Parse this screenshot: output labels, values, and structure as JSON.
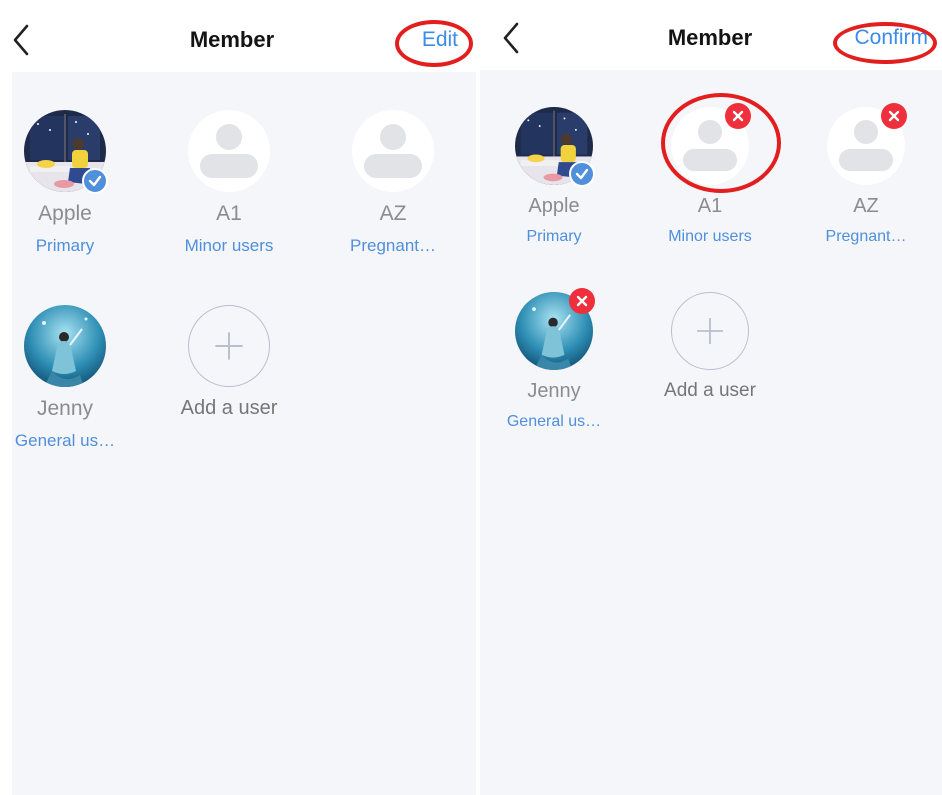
{
  "left_screen": {
    "title": "Member",
    "action_label": "Edit",
    "members": [
      {
        "name": "Apple",
        "role": "Primary",
        "avatar": "photo-girl-night-window",
        "badge": "check-icon"
      },
      {
        "name": "A1",
        "role": "Minor users",
        "avatar": "default-person-icon"
      },
      {
        "name": "AZ",
        "role": "Pregnant…",
        "avatar": "default-person-icon"
      },
      {
        "name": "Jenny",
        "role": "General us…",
        "avatar": "photo-girl-underwater"
      }
    ],
    "add_user_label": "Add a user"
  },
  "right_screen": {
    "title": "Member",
    "action_label": "Confirm",
    "members": [
      {
        "name": "Apple",
        "role": "Primary",
        "avatar": "photo-girl-night-window",
        "badge": "check-icon"
      },
      {
        "name": "A1",
        "role": "Minor users",
        "avatar": "default-person-icon",
        "badge": "delete-icon"
      },
      {
        "name": "AZ",
        "role": "Pregnant…",
        "avatar": "default-person-icon",
        "badge": "delete-icon"
      },
      {
        "name": "Jenny",
        "role": "General us…",
        "avatar": "photo-girl-underwater",
        "badge": "delete-icon"
      }
    ],
    "add_user_label": "Add a user"
  },
  "colors": {
    "accent": "#4f8fdc",
    "delete": "#ef2f3b",
    "annotation": "#e21e1e",
    "background": "#f5f6fa"
  }
}
